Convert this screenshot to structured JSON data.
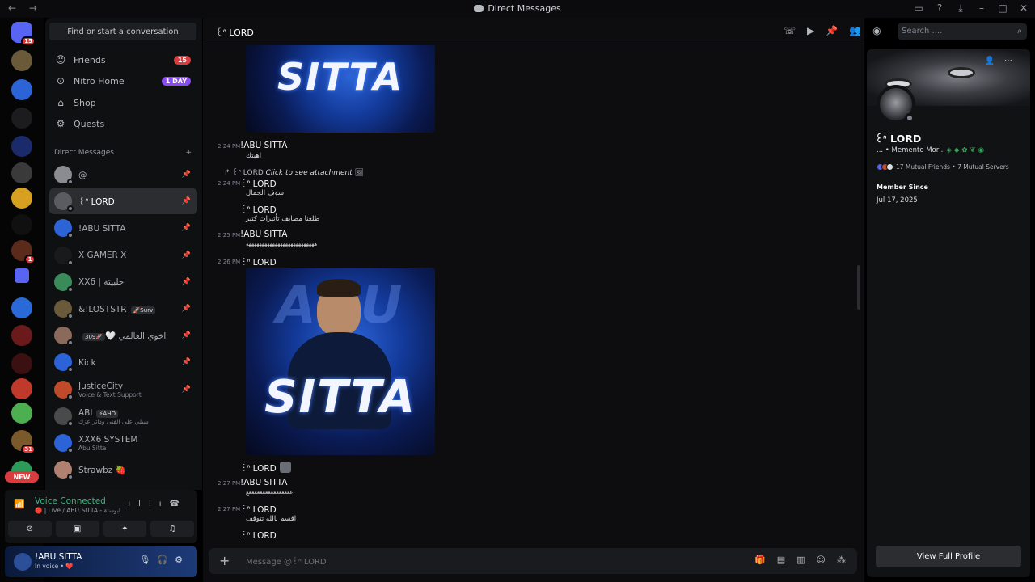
{
  "titlebar": {
    "title": "Direct Messages",
    "nav": "← →",
    "icons": [
      "inbox-icon",
      "help-icon",
      "download-icon",
      "minimize-icon",
      "maximize-icon",
      "close-icon"
    ]
  },
  "guilds": [
    {
      "name": "home",
      "badge": "15",
      "color": "#5865f2"
    },
    {
      "name": "server-1",
      "badge": "",
      "color": "#6b5a3a"
    },
    {
      "name": "server-2",
      "badge": "",
      "color": "#2c64d8"
    },
    {
      "name": "server-3",
      "badge": "",
      "color": "#1c1c1f"
    },
    {
      "name": "server-4",
      "badge": "",
      "color": "#1b2a6a"
    },
    {
      "name": "server-5",
      "badge": "",
      "color": "#3a3a3a"
    },
    {
      "name": "server-6",
      "badge": "",
      "color": "#d8a020"
    },
    {
      "name": "server-7",
      "badge": "",
      "color": "#101010"
    },
    {
      "name": "server-8",
      "badge": "1",
      "color": "#5a2a1a"
    },
    {
      "name": "server-9",
      "badge": "",
      "color": "#5865f2"
    },
    {
      "name": "server-10",
      "badge": "",
      "color": "#2a6ad8"
    },
    {
      "name": "server-11",
      "badge": "",
      "color": "#6a1a1a"
    },
    {
      "name": "server-12",
      "badge": "",
      "color": "#3a1010"
    },
    {
      "name": "server-13",
      "badge": "",
      "color": "#c0392b"
    },
    {
      "name": "server-14",
      "badge": "",
      "color": "#4caf50"
    },
    {
      "name": "server-15",
      "badge": "31",
      "color": "#7a5a2a"
    },
    {
      "name": "server-16",
      "badge": "",
      "color": "#2e9a5a"
    }
  ],
  "new_label": "NEW",
  "sidebar": {
    "search_label": "Find or start a conversation",
    "nav": [
      {
        "label": "Friends",
        "badge": "15",
        "icon": "friends-icon"
      },
      {
        "label": "Nitro Home",
        "badge": "1 DAY",
        "icon": "nitro-icon"
      },
      {
        "label": "Shop",
        "badge": "",
        "icon": "shop-icon"
      },
      {
        "label": "Quests",
        "badge": "",
        "icon": "quests-icon"
      }
    ],
    "dm_header": "Direct Messages",
    "dm_add": "+",
    "dms": [
      {
        "name": "@",
        "sub": "",
        "tag": "",
        "color": "#8a8c91",
        "active": false
      },
      {
        "name": "꒰ᐢ LORD",
        "sub": "",
        "tag": "",
        "color": "#5a5c62",
        "active": true
      },
      {
        "name": "!ABU SITTA",
        "sub": "",
        "tag": "",
        "color": "#2c64d8",
        "active": false
      },
      {
        "name": "X GAMER X",
        "sub": "",
        "tag": "",
        "color": "#1a1a1a",
        "active": false
      },
      {
        "name": "XX6 | حلبيتة",
        "sub": "",
        "tag": "",
        "color": "#3a8a5a",
        "active": false
      },
      {
        "name": "&!LOSTSTR",
        "sub": "",
        "tag": "🚀Surv",
        "color": "#6a5a3a",
        "active": false
      },
      {
        "name": "اخوي العالمي 🤍",
        "sub": "",
        "tag": "🚀309",
        "color": "#8a6a5a",
        "active": false
      },
      {
        "name": "Kick",
        "sub": "",
        "tag": "",
        "color": "#2c64d8",
        "active": false
      },
      {
        "name": "JusticeCity",
        "sub": "Voice & Text Support",
        "tag": "",
        "color": "#c04a2a",
        "active": false
      },
      {
        "name": "ABI",
        "sub": "سبلي على الفتى ودائر عزك",
        "tag": "⚡AHO",
        "color": "#4a4a4a",
        "active": false
      },
      {
        "name": "XXX6 SYSTEM",
        "sub": "Abu Sitta",
        "tag": "",
        "color": "#2c64d8",
        "active": false
      },
      {
        "name": "Strawbz 🍓",
        "sub": "",
        "tag": "",
        "color": "#b08070",
        "active": false
      }
    ]
  },
  "voice": {
    "status": "Voice Connected",
    "channel": "🔴 | Live / ABU SITTA - ابوستة"
  },
  "user": {
    "name": "!ABU SITTA",
    "status": "In voice • ❤️"
  },
  "channel": {
    "name": "꒰ᐢ LORD",
    "search_placeholder": "Search ....",
    "composer_placeholder": "Message @꒰ᐢ LORD"
  },
  "messages": {
    "m1": {
      "time": "2:24 PM",
      "author": "!ABU SITTA",
      "text": "اهيتك"
    },
    "reply": {
      "author": "꒰ᐢ LORD",
      "action": "Click to see attachment"
    },
    "m2": {
      "time": "2:24 PM",
      "author": "꒰ᐢ LORD",
      "text": "شوف الجمال"
    },
    "m3": {
      "author": "꒰ᐢ LORD",
      "text": "طلعنا مصايف تأثيرات كثير"
    },
    "m4": {
      "time": "2:25 PM",
      "author": "!ABU SITTA",
      "text": "ههههههههههههههههههههههههههه"
    },
    "m5": {
      "time": "2:26 PM",
      "author": "꒰ᐢ LORD"
    },
    "image_text_top": "SITTA",
    "image_text_big": "SITTA",
    "image_text_bg": "ABU",
    "m6": {
      "author": "꒰ᐢ LORD"
    },
    "m7": {
      "time": "2:27 PM",
      "author": "!ABU SITTA",
      "text": "ععععععععععععععععع"
    },
    "m8": {
      "time": "2:27 PM",
      "author": "꒰ᐢ LORD",
      "text": "اقسم بالله تتوقف"
    },
    "m9": {
      "author": "꒰ᐢ LORD"
    }
  },
  "profile": {
    "name": "꒰ᐢ LORD",
    "note": "... • Memento Mori.",
    "mutual": "17 Mutual Friends • 7 Mutual Servers",
    "member_label": "Member Since",
    "member_date": "Jul 17, 2025",
    "button": "View Full Profile"
  }
}
